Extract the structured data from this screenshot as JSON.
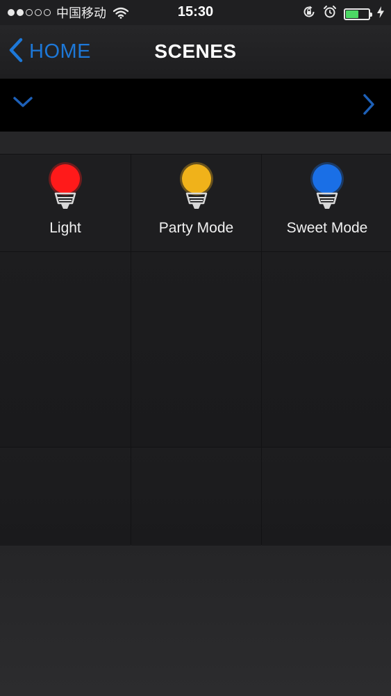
{
  "status_bar": {
    "carrier": "中国移动",
    "time": "15:30",
    "signal_filled": 2,
    "signal_total": 5,
    "battery_level": 0.55,
    "battery_color": "#4cd964"
  },
  "nav": {
    "back_label": "HOME",
    "title": "SCENES",
    "accent_color": "#1d78d8"
  },
  "filter_bar": {
    "left_icon": "chevron-down-icon",
    "right_icon": "chevron-right-icon"
  },
  "scenes": [
    {
      "label": "Light",
      "bulb_color": "#ff1a1a"
    },
    {
      "label": "Party Mode",
      "bulb_color": "#f0b21a"
    },
    {
      "label": "Sweet Mode",
      "bulb_color": "#1a6fe6"
    }
  ]
}
